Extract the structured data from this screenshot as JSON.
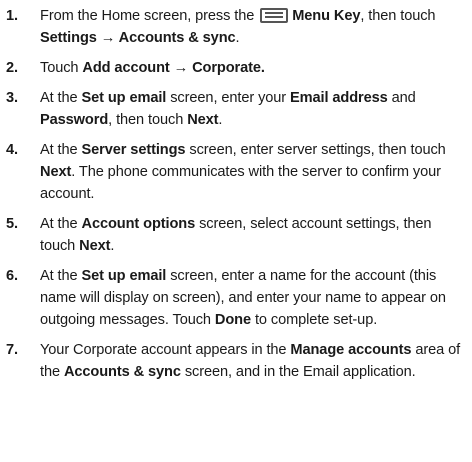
{
  "steps": [
    {
      "number": "1.",
      "t1": "From the Home screen, press the ",
      "icon": "menu-key-icon",
      "menu_key": "Menu Key",
      "t2": ", then touch ",
      "settings_path": "Settings → Accounts & sync",
      "t3": "."
    },
    {
      "number": "2.",
      "t1": "Touch ",
      "add_path": "Add account → Corporate."
    },
    {
      "number": "3.",
      "t1": "At the ",
      "screen": "Set up email",
      "t2": " screen, enter your ",
      "email": "Email address",
      "t3": " and ",
      "password": "Password",
      "t4": ", then touch ",
      "next": "Next",
      "t5": "."
    },
    {
      "number": "4.",
      "t1": "At the ",
      "screen": "Server settings",
      "t2": " screen, enter server settings, then touch ",
      "next": "Next",
      "t3": ". The phone communicates with the server to confirm your account."
    },
    {
      "number": "5.",
      "t1": "At the ",
      "screen": "Account options",
      "t2": " screen, select account settings, then touch ",
      "next": "Next",
      "t3": "."
    },
    {
      "number": "6.",
      "t1": "At the ",
      "screen": "Set up email",
      "t2": " screen, enter a name for the account (this name will display on screen), and enter your name to appear on outgoing messages. Touch ",
      "done": "Done",
      "t3": " to complete set-up."
    },
    {
      "number": "7.",
      "t1": "Your Corporate account appears in the ",
      "manage": "Manage accounts",
      "t2": " area of the ",
      "accounts_sync": "Accounts & sync",
      "t3": " screen, and in the Email application."
    }
  ]
}
